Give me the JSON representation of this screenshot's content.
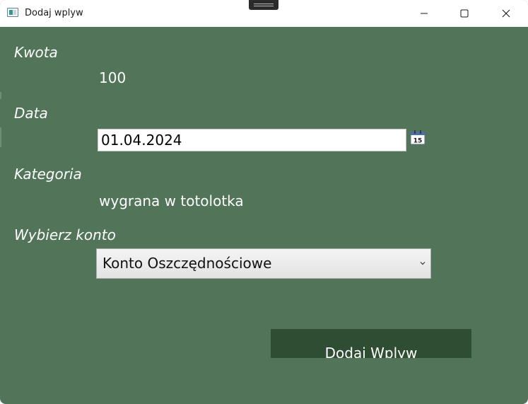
{
  "window": {
    "title": "Dodaj wplyw",
    "background_color": "#52755a",
    "icon": "app-window-icon"
  },
  "controls": {
    "minimize": "minimize-icon",
    "maximize": "maximize-icon",
    "close": "close-icon"
  },
  "form": {
    "amount_label": "Kwota",
    "amount_value": "100",
    "date_label": "Data",
    "date_value": "01.04.2024",
    "calendar_icon_day": "15",
    "category_label": "Kategoria",
    "category_value": "wygrana w totolotka",
    "account_label": "Wybierz konto",
    "account_selected": "Konto Oszczędnościowe",
    "submit_label": "Dodaj Wplyw",
    "submit_color": "#2e4d33"
  }
}
